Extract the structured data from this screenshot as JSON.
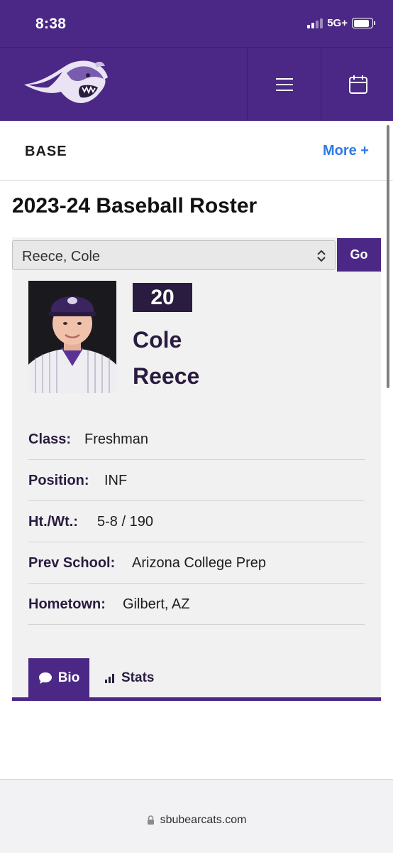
{
  "status_bar": {
    "time": "8:38",
    "network": "5G+",
    "battery_level": 0.85
  },
  "header": {
    "logo": "bearcat-logo",
    "menu_icon": "hamburger-menu-icon",
    "calendar_icon": "calendar-icon"
  },
  "subnav": {
    "title": "BASE",
    "more_label": "More +"
  },
  "page": {
    "title": "2023-24 Baseball Roster"
  },
  "roster_select": {
    "selected": "Reece, Cole",
    "go_label": "Go"
  },
  "player": {
    "number": "20",
    "first_name": "Cole",
    "last_name": "Reece",
    "details": [
      {
        "label": "Class:",
        "value": "Freshman"
      },
      {
        "label": "Position:",
        "value": "INF"
      },
      {
        "label": "Ht./Wt.:",
        "value": "5-8 / 190"
      },
      {
        "label": "Prev School:",
        "value": "Arizona College Prep"
      },
      {
        "label": "Hometown:",
        "value": "Gilbert, AZ"
      }
    ]
  },
  "tabs": [
    {
      "label": "Bio",
      "icon": "speech-bubble-icon",
      "active": true
    },
    {
      "label": "Stats",
      "icon": "bar-chart-icon",
      "active": false
    }
  ],
  "browser": {
    "url": "sbubearcats.com"
  },
  "colors": {
    "brand_purple": "#4b2885",
    "dark_purple": "#2a1c40",
    "link_blue": "#2f7be6"
  }
}
